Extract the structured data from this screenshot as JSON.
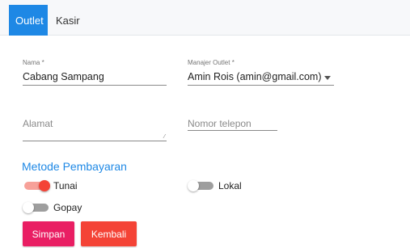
{
  "tabs": [
    {
      "label": "Outlet",
      "active": true
    },
    {
      "label": "Kasir",
      "active": false
    }
  ],
  "form": {
    "nama": {
      "label": "Nama *",
      "value": "Cabang Sampang"
    },
    "manajer": {
      "label": "Manajer Outlet *",
      "value": "Amin Rois (amin@gmail.com)"
    },
    "alamat": {
      "placeholder": "Alamat",
      "value": ""
    },
    "telepon": {
      "placeholder": "Nomor telepon",
      "value": ""
    }
  },
  "payment": {
    "title": "Metode Pembayaran",
    "options": [
      {
        "label": "Tunai",
        "enabled": true
      },
      {
        "label": "Lokal",
        "enabled": false
      },
      {
        "label": "Gopay",
        "enabled": false
      }
    ]
  },
  "actions": {
    "save_label": "Simpan",
    "back_label": "Kembali"
  },
  "colors": {
    "primary": "#1e88e5",
    "save": "#e91e63",
    "back": "#f44336",
    "switch_on": "#f44336"
  }
}
